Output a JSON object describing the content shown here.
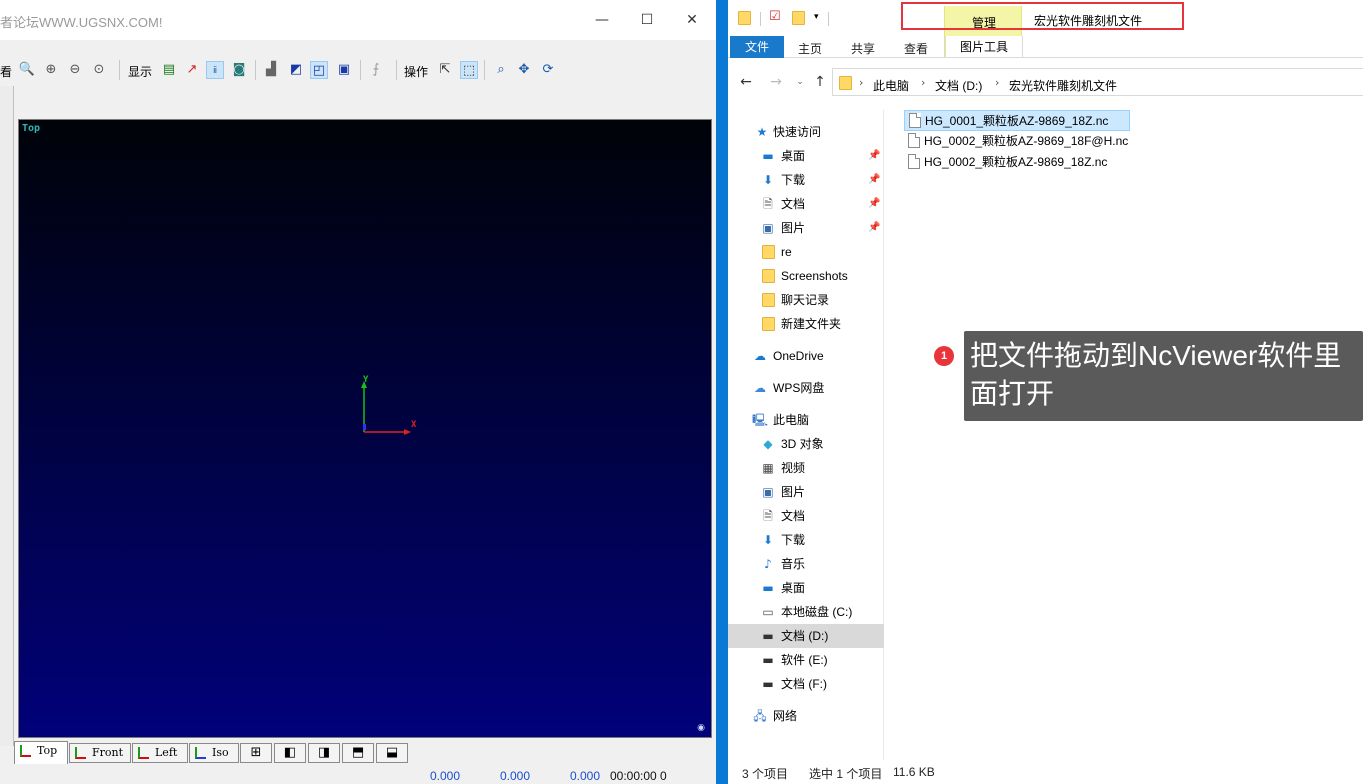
{
  "ncviewer": {
    "title": "者论坛WWW.UGSNX.COM!",
    "window_buttons": {
      "minimize": "—",
      "maximize": "☐",
      "close": "✕"
    },
    "toolbar": {
      "view_label_fragment": "看",
      "display_label": "显示",
      "operation_label": "操作"
    },
    "viewport": {
      "view_name": "Top",
      "axis_x": "X",
      "axis_y": "Y",
      "axis_z": "Z",
      "background_top": "#000308",
      "background_bottom": "#01017a"
    },
    "view_tabs": [
      {
        "label": "Top",
        "active": true
      },
      {
        "label": "Front",
        "active": false
      },
      {
        "label": "Left",
        "active": false
      },
      {
        "label": "Iso",
        "active": false
      }
    ],
    "status": {
      "x": "0.000",
      "y": "0.000",
      "z": "0.000",
      "time": "00:00:00 0"
    }
  },
  "explorer": {
    "window_title": "宏光软件雕刻机文件",
    "ribbon": {
      "file_tab": "文件",
      "tabs": [
        "主页",
        "共享",
        "查看"
      ],
      "context_group": "管理",
      "context_tab": "图片工具"
    },
    "address": {
      "crumbs": [
        "此电脑",
        "文档 (D:)",
        "宏光软件雕刻机文件"
      ]
    },
    "nav": {
      "quick_access": "快速访问",
      "quick_items": [
        {
          "label": "桌面",
          "icon": "desktop-icon",
          "pinned": true
        },
        {
          "label": "下载",
          "icon": "download-icon",
          "pinned": true
        },
        {
          "label": "文档",
          "icon": "document-icon",
          "pinned": true
        },
        {
          "label": "图片",
          "icon": "picture-icon",
          "pinned": true
        },
        {
          "label": "re",
          "icon": "folder-icon",
          "pinned": false
        },
        {
          "label": "Screenshots",
          "icon": "folder-icon",
          "pinned": false
        },
        {
          "label": "聊天记录",
          "icon": "folder-icon",
          "pinned": false
        },
        {
          "label": "新建文件夹",
          "icon": "folder-icon",
          "pinned": false
        }
      ],
      "onedrive": "OneDrive",
      "wps": "WPS网盘",
      "this_pc": "此电脑",
      "pc_items": [
        {
          "label": "3D 对象",
          "icon": "3d-objects-icon"
        },
        {
          "label": "视频",
          "icon": "video-icon"
        },
        {
          "label": "图片",
          "icon": "picture-icon"
        },
        {
          "label": "文档",
          "icon": "document-icon"
        },
        {
          "label": "下载",
          "icon": "download-icon"
        },
        {
          "label": "音乐",
          "icon": "music-icon"
        },
        {
          "label": "桌面",
          "icon": "desktop-icon"
        },
        {
          "label": "本地磁盘 (C:)",
          "icon": "drive-icon"
        },
        {
          "label": "文档 (D:)",
          "icon": "drive-icon",
          "selected": true
        },
        {
          "label": "软件 (E:)",
          "icon": "drive-icon"
        },
        {
          "label": "文档 (F:)",
          "icon": "drive-icon"
        }
      ],
      "network": "网络"
    },
    "files": [
      {
        "name": "HG_0001_颗粒板AZ-9869_18Z.nc",
        "selected": true
      },
      {
        "name": "HG_0002_颗粒板AZ-9869_18F@H.nc",
        "selected": false
      },
      {
        "name": "HG_0002_颗粒板AZ-9869_18Z.nc",
        "selected": false
      }
    ],
    "status": {
      "item_count": "3 个项目",
      "selected": "选中 1 个项目",
      "size": "11.6 KB"
    }
  },
  "annotation": {
    "step_number": "1",
    "instruction": "把文件拖动到NcViewer软件里面打开",
    "highlight_color": "#e3353b"
  }
}
